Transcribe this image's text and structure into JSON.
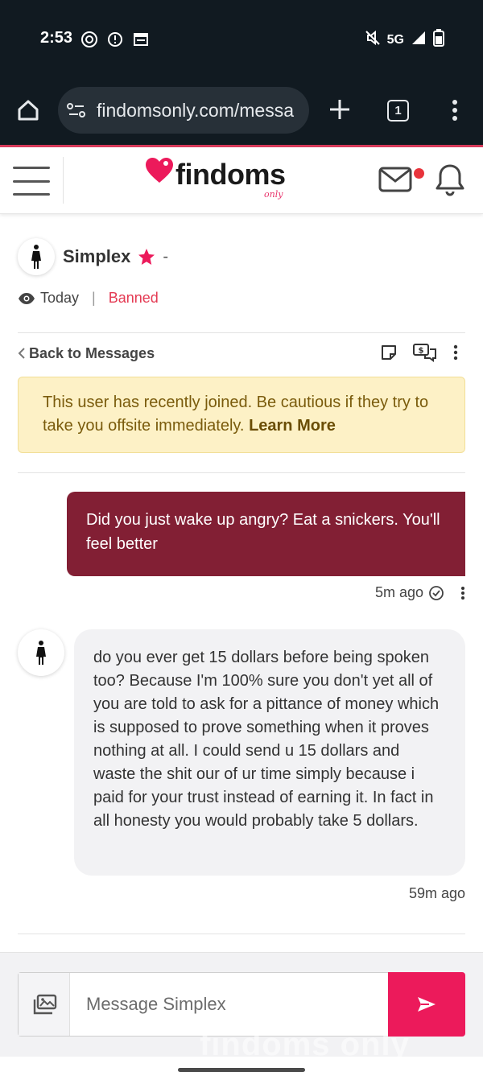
{
  "status_bar": {
    "time": "2:53",
    "network": "5G",
    "icons": [
      "whatsapp-icon",
      "alert-icon",
      "calendar-icon",
      "mute-icon",
      "signal-icon",
      "battery-icon"
    ]
  },
  "browser": {
    "url": "findomsonly.com/messa",
    "tab_count": "1",
    "icons": [
      "home-icon",
      "site-settings-icon",
      "new-tab-icon",
      "tabs-icon",
      "more-icon"
    ]
  },
  "site_header": {
    "logo_text": "findoms",
    "logo_sub": "only",
    "accent_color": "#ec1a5b",
    "notification_dot_color": "#e8333b"
  },
  "profile": {
    "name": "Simplex",
    "suffix": "-",
    "last_seen": "Today",
    "status": "Banned",
    "status_color": "#e43b54"
  },
  "thread": {
    "back_label": "Back to Messages",
    "action_icons": [
      "note-icon",
      "tip-chat-icon",
      "more-vertical-icon"
    ]
  },
  "alert": {
    "text": "This user has recently joined. Be cautious if they try to take you offsite immediately.",
    "link": "Learn More"
  },
  "messages": [
    {
      "direction": "sent",
      "text": "Did you just wake up angry? Eat a snickers. You'll feel better",
      "time": "5m ago",
      "bubble_color": "#821f34"
    },
    {
      "direction": "received",
      "text": "do you ever get 15 dollars before being spoken too? Because I'm 100% sure you don't yet all of you are told to ask for a pittance of money which is supposed to prove something when it proves nothing at all. I could send u 15 dollars and waste the shit our of ur time simply because i paid for your trust instead of earning it. In fact in all honesty you would probably take 5 dollars.",
      "time": "59m ago"
    }
  ],
  "composer": {
    "placeholder": "Message Simplex",
    "value": ""
  },
  "watermark": "findoms only"
}
